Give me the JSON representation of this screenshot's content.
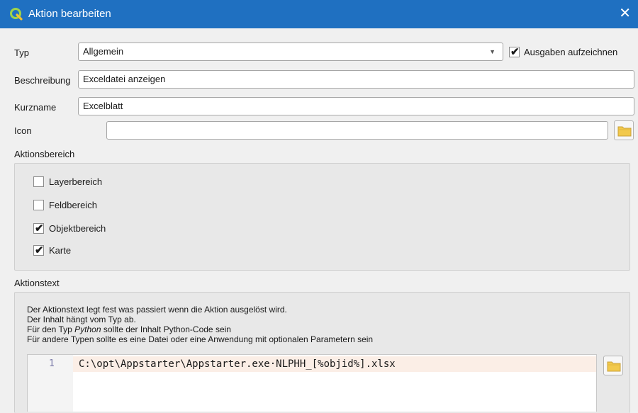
{
  "window": {
    "title": "Aktion bearbeiten",
    "close_glyph": "✕"
  },
  "form": {
    "typ_label": "Typ",
    "typ_value": "Allgemein",
    "ausgaben_label": "Ausgaben aufzeichnen",
    "ausgaben_checked": true,
    "beschreibung_label": "Beschreibung",
    "beschreibung_value": "Exceldatei anzeigen",
    "kurzname_label": "Kurzname",
    "kurzname_value": "Excelblatt",
    "icon_label": "Icon",
    "icon_value": ""
  },
  "aktionsbereich": {
    "label": "Aktionsbereich",
    "items": [
      {
        "label": "Layerbereich",
        "checked": false
      },
      {
        "label": "Feldbereich",
        "checked": false
      },
      {
        "label": "Objektbereich",
        "checked": true
      },
      {
        "label": "Karte",
        "checked": true
      }
    ]
  },
  "aktionstext": {
    "label": "Aktionstext",
    "help_line1": "Der Aktionstext legt fest was passiert wenn die Aktion ausgelöst wird.",
    "help_line2": "Der Inhalt hängt vom Typ ab.",
    "help_line3_prefix": "Für den Typ ",
    "help_line3_em": "Python",
    "help_line3_suffix": " sollte der Inhalt Python-Code sein",
    "help_line4": "Für andere Typen sollte es eine Datei oder eine Anwendung mit optionalen Parametern sein",
    "line_number": "1",
    "code": "C:\\opt\\Appstarter\\Appstarter.exe·NLPHH_[%objid%].xlsx"
  },
  "icons": {
    "app": "qgis-icon",
    "folder": "folder-icon",
    "checkmark": "✔"
  },
  "colors": {
    "titlebar": "#1f70c1",
    "folder": "#f2c94c",
    "current_line": "#fbeee6"
  }
}
